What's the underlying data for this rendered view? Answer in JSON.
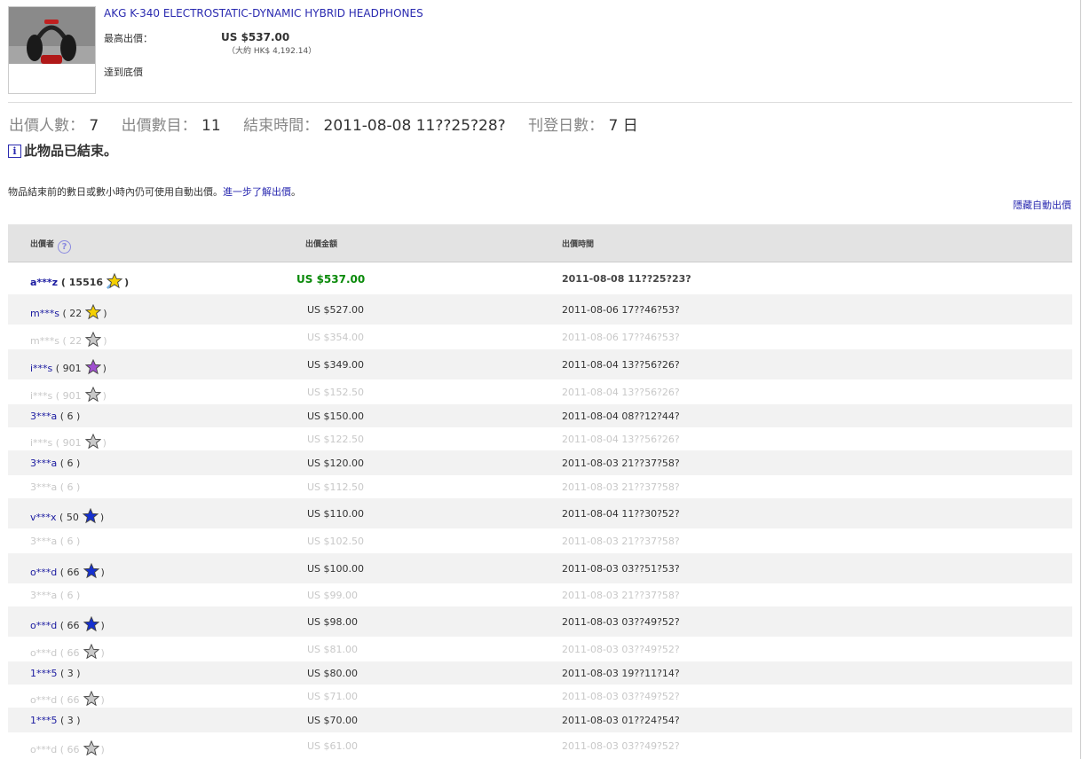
{
  "item": {
    "title": "AKG K-340 ELECTROSTATIC-DYNAMIC HYBRID HEADPHONES",
    "high_bid_label": "最高出價：",
    "high_bid": "US $537.00",
    "approx": "（大約 HK$ 4,192.14）",
    "reserve": "達到底價"
  },
  "summary": {
    "bidders_label": "出價人數：",
    "bidders": "7",
    "bids_label": "出價數目：",
    "bids": "11",
    "end_label": "結束時間：",
    "end_time": "2011-08-08 11??25?28?",
    "duration_label": "刊登日數：",
    "duration": "7 日",
    "ended": "此物品已結束。",
    "info_icon": "i"
  },
  "autobid": {
    "text": "物品結束前的數日或數小時內仍可使用自動出價。",
    "link": "進一步了解出價",
    "tail": "。",
    "hide_link": "隱藏自動出價"
  },
  "table": {
    "headers": {
      "bidder": "出價者",
      "amount": "出價金額",
      "time": "出價時間"
    },
    "help_icon": "?",
    "rows": [
      {
        "bidder": "a***z",
        "score": "15516",
        "star": "yellow-shooting",
        "amount": "US $537.00",
        "time": "2011-08-08 11??25?23?",
        "kind": "top"
      },
      {
        "bidder": "m***s",
        "score": "22",
        "star": "yellow",
        "amount": "US $527.00",
        "time": "2011-08-06 17??46?53?",
        "kind": "bid"
      },
      {
        "bidder": "m***s",
        "score": "22",
        "star": "gray",
        "amount": "US $354.00",
        "time": "2011-08-06 17??46?53?",
        "kind": "ghost"
      },
      {
        "bidder": "i***s",
        "score": "901",
        "star": "purple",
        "amount": "US $349.00",
        "time": "2011-08-04 13??56?26?",
        "kind": "bid"
      },
      {
        "bidder": "i***s",
        "score": "901",
        "star": "gray",
        "amount": "US $152.50",
        "time": "2011-08-04 13??56?26?",
        "kind": "ghost"
      },
      {
        "bidder": "3***a",
        "score": "6",
        "star": "",
        "amount": "US $150.00",
        "time": "2011-08-04 08??12?44?",
        "kind": "bid"
      },
      {
        "bidder": "i***s",
        "score": "901",
        "star": "gray",
        "amount": "US $122.50",
        "time": "2011-08-04 13??56?26?",
        "kind": "ghost"
      },
      {
        "bidder": "3***a",
        "score": "6",
        "star": "",
        "amount": "US $120.00",
        "time": "2011-08-03 21??37?58?",
        "kind": "bid"
      },
      {
        "bidder": "3***a",
        "score": "6",
        "star": "",
        "amount": "US $112.50",
        "time": "2011-08-03 21??37?58?",
        "kind": "ghost"
      },
      {
        "bidder": "v***x",
        "score": "50",
        "star": "blue",
        "amount": "US $110.00",
        "time": "2011-08-04 11??30?52?",
        "kind": "bid"
      },
      {
        "bidder": "3***a",
        "score": "6",
        "star": "",
        "amount": "US $102.50",
        "time": "2011-08-03 21??37?58?",
        "kind": "ghost"
      },
      {
        "bidder": "o***d",
        "score": "66",
        "star": "blue",
        "amount": "US $100.00",
        "time": "2011-08-03 03??51?53?",
        "kind": "bid"
      },
      {
        "bidder": "3***a",
        "score": "6",
        "star": "",
        "amount": "US $99.00",
        "time": "2011-08-03 21??37?58?",
        "kind": "ghost"
      },
      {
        "bidder": "o***d",
        "score": "66",
        "star": "blue",
        "amount": "US $98.00",
        "time": "2011-08-03 03??49?52?",
        "kind": "bid"
      },
      {
        "bidder": "o***d",
        "score": "66",
        "star": "gray",
        "amount": "US $81.00",
        "time": "2011-08-03 03??49?52?",
        "kind": "ghost"
      },
      {
        "bidder": "1***5",
        "score": "3",
        "star": "",
        "amount": "US $80.00",
        "time": "2011-08-03 19??11?14?",
        "kind": "bid"
      },
      {
        "bidder": "o***d",
        "score": "66",
        "star": "gray",
        "amount": "US $71.00",
        "time": "2011-08-03 03??49?52?",
        "kind": "ghost"
      },
      {
        "bidder": "1***5",
        "score": "3",
        "star": "",
        "amount": "US $70.00",
        "time": "2011-08-03 01??24?54?",
        "kind": "bid"
      },
      {
        "bidder": "o***d",
        "score": "66",
        "star": "gray",
        "amount": "US $61.00",
        "time": "2011-08-03 03??49?52?",
        "kind": "ghost"
      }
    ]
  },
  "colors": {
    "link": "#2a2ab0",
    "winning_amount": "#0a8a0a",
    "ghost_text": "#c8c8c8",
    "row_shade": "#f2f2f2",
    "header_bg": "#e3e3e3",
    "star_yellow": "#f5d000",
    "star_purple": "#a050d0",
    "star_blue": "#1530d0",
    "star_gray": "#c9c9c9"
  }
}
